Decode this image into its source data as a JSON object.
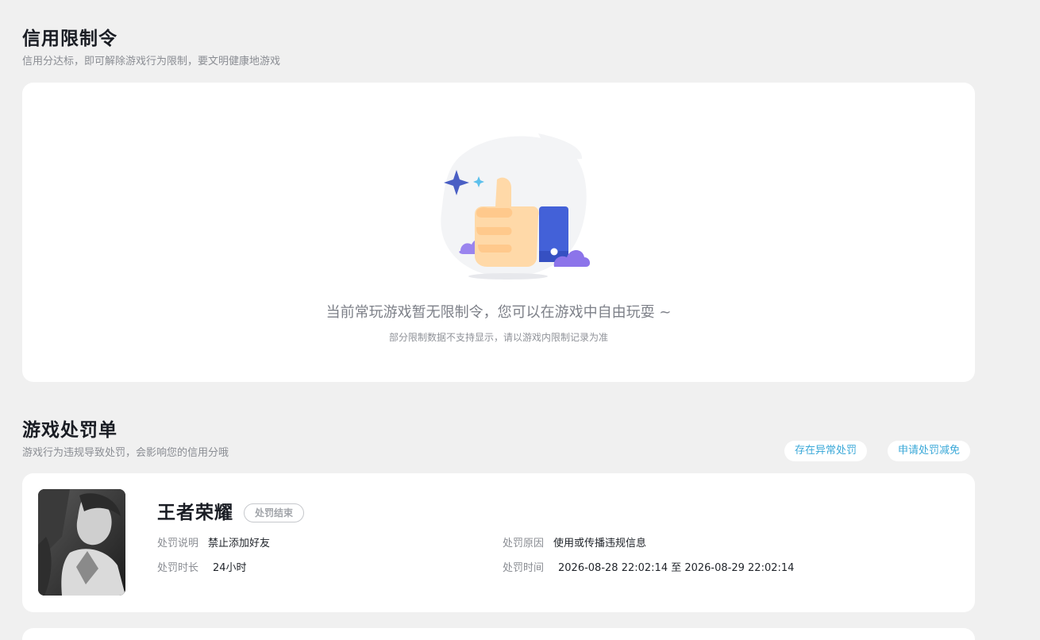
{
  "credit_section": {
    "title": "信用限制令",
    "subtitle": "信用分达标，即可解除游戏行为限制，要文明健康地游戏",
    "empty": {
      "message": "当前常玩游戏暂无限制令，您可以在游戏中自由玩耍 ~",
      "note": "部分限制数据不支持显示，请以游戏内限制记录为准"
    }
  },
  "penalty_section": {
    "title": "游戏处罚单",
    "subtitle": "游戏行为违规导致处罚，会影响您的信用分哦",
    "buttons": {
      "abnormal": "存在异常处罚",
      "reduce": "申请处罚减免"
    },
    "records": [
      {
        "game": "王者荣耀",
        "status": "处罚结束",
        "desc_label": "处罚说明",
        "desc_value": "禁止添加好友",
        "reason_label": "处罚原因",
        "reason_value": "使用或传播违规信息",
        "duration_label": "处罚时长",
        "duration_value": "24小时",
        "time_label": "处罚时间",
        "time_value": "2026-08-28 22:02:14 至 2026-08-29 22:02:14"
      }
    ]
  },
  "colors": {
    "accent": "#3aa8d8",
    "background": "#f0f0f0",
    "thumb_blue": "#4361d8",
    "thumb_skin": "#ffd9a8",
    "cloud_purple": "#8c74ea"
  },
  "icons": {
    "empty_illustration": "thumbs-up-icon"
  }
}
